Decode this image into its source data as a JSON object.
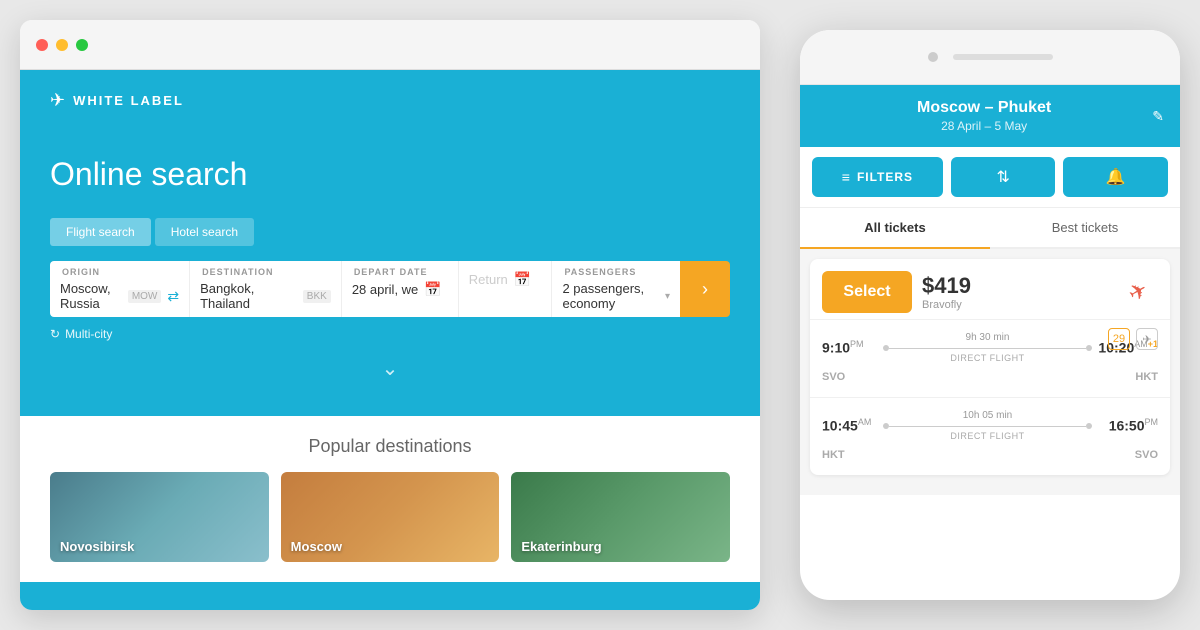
{
  "scene": {
    "background": "#e8e8e8"
  },
  "desktop": {
    "browser_dots": [
      "red",
      "yellow",
      "green"
    ],
    "logo": {
      "icon": "✈",
      "text": "WHITE LABEL"
    },
    "hero": {
      "title": "Online search",
      "tabs": [
        "Flight search",
        "Hotel search"
      ],
      "active_tab": 0
    },
    "form": {
      "origin_label": "ORIGIN",
      "origin_value": "Moscow, Russia",
      "origin_code": "MOW",
      "destination_label": "DESTINATION",
      "destination_value": "Bangkok, Thailand",
      "destination_code": "BKK",
      "depart_label": "DEPART DATE",
      "depart_value": "28 april, we",
      "return_placeholder": "Return",
      "passengers_label": "PASSENGERS",
      "passengers_value": "2 passengers, economy",
      "multi_city": "Multi-city"
    },
    "popular": {
      "title": "Popular destinations",
      "destinations": [
        {
          "name": "Novosibirsk",
          "color_from": "#4a7c8b",
          "color_to": "#6aabb5"
        },
        {
          "name": "Moscow",
          "color_from": "#c47d3e",
          "color_to": "#e8b566"
        },
        {
          "name": "Ekaterinburg",
          "color_from": "#3a7a4a",
          "color_to": "#7ab588"
        }
      ]
    }
  },
  "mobile": {
    "header": {
      "route": "Moscow – Phuket",
      "dates": "28 April – 5 May",
      "edit_icon": "✎"
    },
    "filters": {
      "main_btn": "FILTERS",
      "filter_icon": "⇅",
      "bell_icon": "🔔"
    },
    "tabs": [
      {
        "label": "All tickets",
        "active": true
      },
      {
        "label": "Best tickets",
        "active": false
      }
    ],
    "ticket": {
      "select_label": "Select",
      "price": "$419",
      "provider": "Bravofly",
      "airline_icon": "✈",
      "segments": [
        {
          "depart_time": "9:10",
          "depart_suffix": "PM",
          "duration": "9h 30 min",
          "flight_type": "DIRECT FLIGHT",
          "arrive_time": "10:20",
          "arrive_suffix": "AM",
          "plus_day": "+1",
          "from_airport": "SVO",
          "to_airport": "HKT",
          "icons": [
            {
              "label": "29",
              "type": "normal"
            },
            {
              "label": "✈",
              "type": "normal"
            }
          ]
        },
        {
          "depart_time": "10:45",
          "depart_suffix": "AM",
          "duration": "10h 05 min",
          "flight_type": "DIRECT FLIGHT",
          "arrive_time": "16:50",
          "arrive_suffix": "PM",
          "plus_day": "",
          "from_airport": "HKT",
          "to_airport": "SVO",
          "icons": []
        }
      ]
    }
  }
}
